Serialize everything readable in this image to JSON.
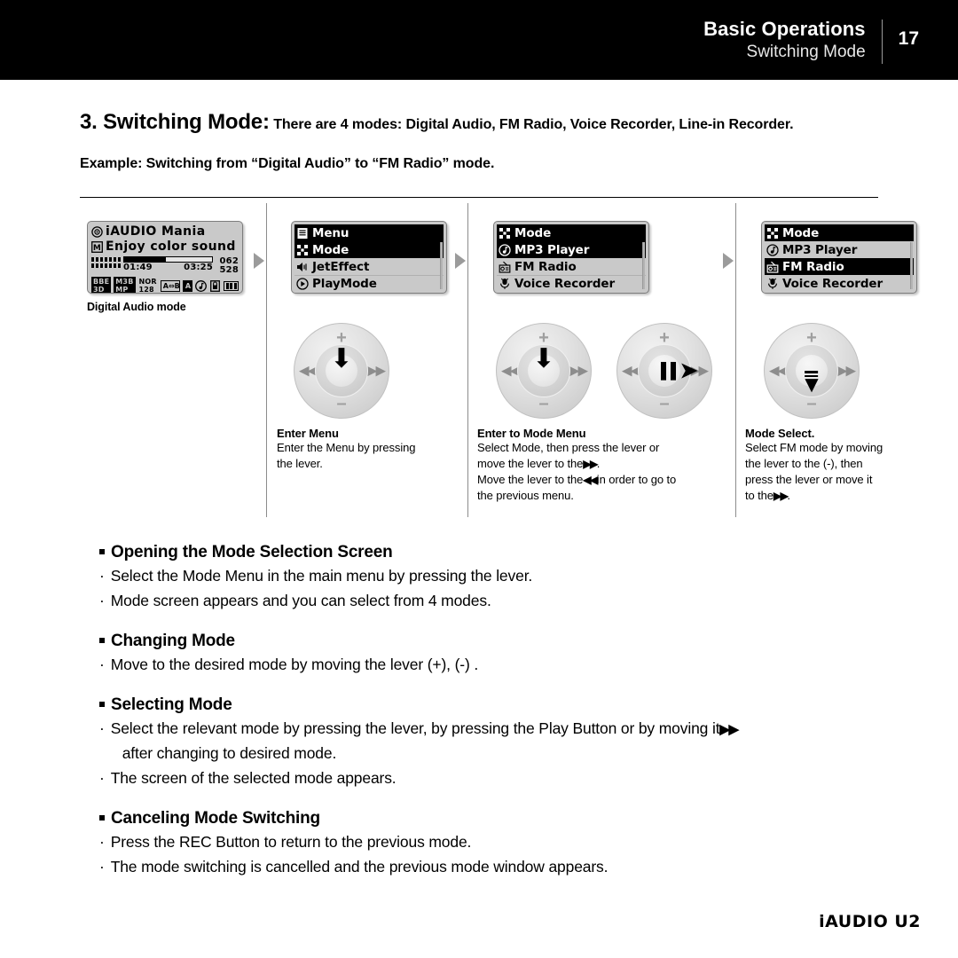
{
  "header": {
    "main_title": "Basic Operations",
    "sub_title": "Switching Mode",
    "page_number": "17"
  },
  "title": {
    "number_heading": "3. Switching Mode:",
    "description": "There are 4 modes: Digital Audio, FM Radio, Voice Recorder, Line-in Recorder.",
    "example": "Example: Switching from “Digital Audio” to “FM Radio” mode."
  },
  "diagram": {
    "step1": {
      "caption": "Digital Audio mode",
      "lcd": {
        "title_icon": "disc-icon",
        "title": "iAUDIO Mania",
        "subtitle_icon": "m-badge-icon",
        "subtitle": "Enjoy color sound",
        "elapsed_time": "01:49",
        "total_time": "03:25",
        "track_current": "062",
        "track_total": "528",
        "progress_percent": 47,
        "status_bbe": "BBE",
        "status_3d": "3D",
        "status_m3b": "M3B",
        "status_mp": "MP",
        "status_nor": "NOR",
        "status_bitrate": "128",
        "status_ab": "A⇔B",
        "status_repeat": "A",
        "status_music": "music-note-icon",
        "status_lock": "lock-icon",
        "status_battery": "battery-icon"
      }
    },
    "step2": {
      "lcd_rows": [
        {
          "icon": "clipboard-icon",
          "label": "Menu",
          "selected": true
        },
        {
          "icon": "mode-grid-icon",
          "label": "Mode",
          "selected": true
        },
        {
          "icon": "speaker-icon",
          "label": "JetEffect",
          "selected": false
        },
        {
          "icon": "play-circle-icon",
          "label": "PlayMode",
          "selected": false
        }
      ],
      "stick": {
        "plus": "+",
        "minus": "–",
        "left": "◀◀",
        "right": "▶▶",
        "action": "press-down"
      },
      "cap_title": "Enter Menu",
      "cap_body_1": "Enter the Menu by pressing",
      "cap_body_2": "the lever."
    },
    "step3": {
      "lcd_rows": [
        {
          "icon": "mode-grid-icon",
          "label": "Mode",
          "selected": true
        },
        {
          "icon": "music-note-icon",
          "label": "MP3 Player",
          "selected": true
        },
        {
          "icon": "radio-icon",
          "label": "FM Radio",
          "selected": false
        },
        {
          "icon": "microphone-icon",
          "label": "Voice Recorder",
          "selected": false
        }
      ],
      "stick_a": {
        "plus": "+",
        "minus": "–",
        "left": "◀◀",
        "right": "▶▶",
        "action": "press-down"
      },
      "stick_b": {
        "plus": "+",
        "minus": "–",
        "left": "◀◀",
        "right": "▶▶",
        "action": "move-right"
      },
      "cap_title": "Enter to Mode Menu",
      "cap_line_1a": "Select Mode, then press the lever or",
      "cap_line_1b": "move the lever to the",
      "cap_line_1c": ".",
      "cap_line_2a": "Move the lever to the",
      "cap_line_2b": "in order to go to",
      "cap_line_2c": "the previous menu."
    },
    "step4": {
      "lcd_rows": [
        {
          "icon": "mode-grid-icon",
          "label": "Mode",
          "selected": true
        },
        {
          "icon": "music-note-icon",
          "label": "MP3 Player",
          "selected": false
        },
        {
          "icon": "radio-icon",
          "label": "FM Radio",
          "selected": true
        },
        {
          "icon": "microphone-icon",
          "label": "Voice Recorder",
          "selected": false
        }
      ],
      "stick": {
        "plus": "+",
        "minus": "–",
        "left": "◀◀",
        "right": "▶▶",
        "action": "move-down"
      },
      "cap_title": "Mode Select.",
      "cap_line_1": "Select FM mode by moving",
      "cap_line_2": "the lever to the (-), then",
      "cap_line_3": "press the lever or move it",
      "cap_line_4a": "to the",
      "cap_line_4b": "."
    }
  },
  "sections": [
    {
      "heading": "Opening the Mode Selection Screen",
      "bullets": [
        "Select the Mode Menu in the main menu by pressing the lever.",
        "Mode screen appears and you can select from 4 modes."
      ]
    },
    {
      "heading": "Changing Mode",
      "bullets": [
        "Move to the desired mode by moving the lever (+), (-) ."
      ]
    },
    {
      "heading": "Selecting Mode",
      "bullets": [
        "Select the relevant mode by pressing the lever, by pressing the Play Button or by moving it",
        "The screen of the selected mode appears."
      ],
      "continuation": "after changing to desired mode."
    },
    {
      "heading": "Canceling Mode Switching",
      "bullets": [
        "Press the REC Button to return to the previous mode.",
        "The mode switching is cancelled and the previous mode window appears."
      ]
    }
  ],
  "footer": {
    "brand": "iAUDIO U2"
  },
  "glyphs": {
    "bullet_dot": "·",
    "fast_forward": "▶▶",
    "rewind": "◀◀",
    "down_arrow": "⬇"
  },
  "colors": {
    "header_bg": "#000000",
    "lcd_bg": "#c9c9c9",
    "lcd_selected_bg": "#000000",
    "stick_gray": "#dcdcdc",
    "divider": "#8c8c8c"
  }
}
